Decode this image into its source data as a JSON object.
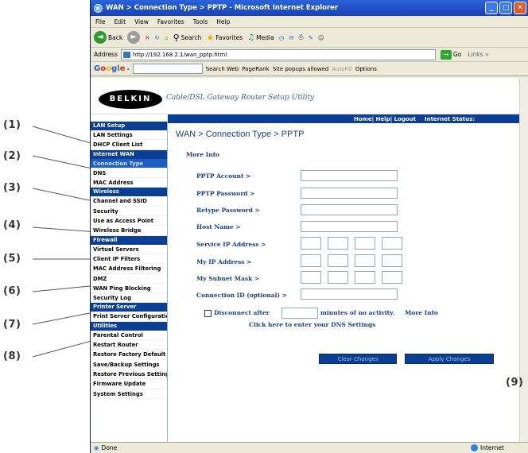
{
  "browser": {
    "title": "WAN > Connection Type > PPTP - Microsoft Internet Explorer",
    "menu": [
      "File",
      "Edit",
      "View",
      "Favorites",
      "Tools",
      "Help"
    ],
    "toolbar": {
      "back": "Back",
      "search": "Search",
      "favorites": "Favorites",
      "media": "Media"
    },
    "address_label": "Address",
    "address_value": "http://192.168.2.1/wan_pptp.html",
    "go_label": "Go",
    "links_label": "Links »",
    "google": {
      "logo": "Google -",
      "search_web": "Search Web",
      "pagerank": "PageRank",
      "popups": "Site popups allowed",
      "autofill": "AutoFill",
      "options": "Options"
    },
    "status_left": "Done",
    "status_right": "Internet"
  },
  "header": {
    "logo": "BELKIN",
    "tagline": "Cable/DSL Gateway Router Setup Utility",
    "nav": "Home| Help| Logout",
    "internet_status_label": "Internet Status:"
  },
  "sidebar": {
    "sections": [
      {
        "title": "LAN Setup",
        "items": [
          "LAN Settings",
          "DHCP Client List"
        ]
      },
      {
        "title": "Internet WAN",
        "items": [
          "Connection Type",
          "DNS",
          "MAC Address"
        ]
      },
      {
        "title": "Wireless",
        "items": [
          "Channel and SSID",
          "Security",
          "Use as Access Point",
          "Wireless Bridge"
        ]
      },
      {
        "title": "Firewall",
        "items": [
          "Virtual Servers",
          "Client IP Filters",
          "MAC Address Filtering",
          "DMZ",
          "WAN Ping Blocking",
          "Security Log"
        ]
      },
      {
        "title": "Printer Server",
        "items": [
          "Print Server Configuration"
        ]
      },
      {
        "title": "Utilities",
        "items": [
          "Parental Control",
          "Restart Router",
          "Restore Factory Default",
          "Save/Backup Settings",
          "Restore Previous Settings",
          "Firmware Update",
          "System Settings"
        ]
      }
    ],
    "active_item": "Connection Type"
  },
  "form": {
    "breadcrumb": "WAN > Connection Type > PPTP",
    "more_info": "More Info",
    "pptp_account": "PPTP Account >",
    "pptp_password": "PPTP Password >",
    "retype_password": "Retype Password >",
    "host_name": "Host Name >",
    "service_ip": "Service IP Address >",
    "my_ip": "My IP Address >",
    "subnet_mask": "My Subnet Mask >",
    "connection_id": "Connection ID (optional) >",
    "disconnect_prefix": "Disconnect after",
    "disconnect_suffix": "minutes of no activity.",
    "disconnect_more_info": "More Info",
    "dns_link": "Click here to enter your DNS Settings",
    "clear_button": "Clear Changes",
    "apply_button": "Apply Changes"
  },
  "callouts": [
    "(1)",
    "(2)",
    "(3)",
    "(4)",
    "(5)",
    "(6)",
    "(7)",
    "(8)",
    "(9)"
  ]
}
